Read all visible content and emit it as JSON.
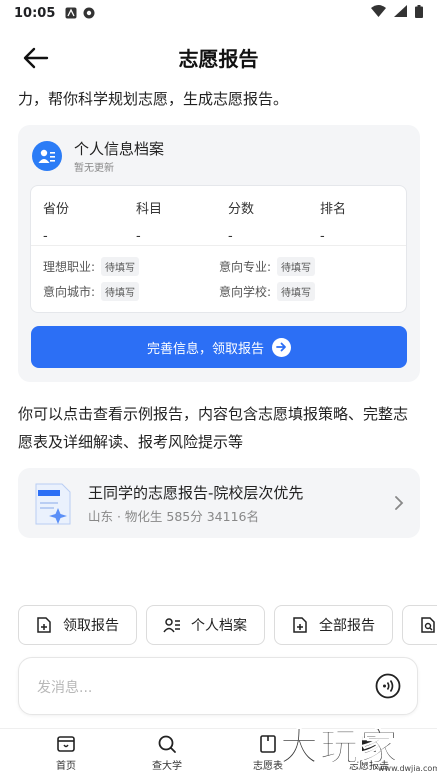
{
  "status_bar": {
    "time": "10:05"
  },
  "header": {
    "title": "志愿报告",
    "back_icon": "arrow-left-icon"
  },
  "intro": "力，帮你科学规划志愿，生成志愿报告。",
  "profile": {
    "title": "个人信息档案",
    "subtitle": "暂无更新",
    "scores": [
      {
        "label": "省份",
        "value": "-"
      },
      {
        "label": "科目",
        "value": "-"
      },
      {
        "label": "分数",
        "value": "-"
      },
      {
        "label": "排名",
        "value": "-"
      }
    ],
    "prefs": [
      {
        "label": "理想职业:",
        "tag": "待填写"
      },
      {
        "label": "意向专业:",
        "tag": "待填写"
      },
      {
        "label": "意向城市:",
        "tag": "待填写"
      },
      {
        "label": "意向学校:",
        "tag": "待填写"
      }
    ],
    "button": "完善信息，领取报告",
    "accent": "#2c6ff5"
  },
  "description": "你可以点击查看示例报告，内容包含志愿填报策略、完整志愿表及详细解读、报考风险提示等",
  "sample_report": {
    "title": "王同学的志愿报告-院校层次优先",
    "meta": "山东 · 物化生 585分 34116名"
  },
  "chips": [
    {
      "label": "领取报告",
      "icon": "report-add-icon"
    },
    {
      "label": "个人档案",
      "icon": "profile-icon"
    },
    {
      "label": "全部报告",
      "icon": "report-list-icon"
    },
    {
      "label": "",
      "icon": "report-search-icon"
    }
  ],
  "composer": {
    "placeholder": "发消息..."
  },
  "tabs": [
    {
      "label": "首页",
      "icon": "home-icon"
    },
    {
      "label": "查大学",
      "icon": "search-icon"
    },
    {
      "label": "志愿表",
      "icon": "bookmark-icon"
    },
    {
      "label": "志愿报告",
      "icon": "report-icon"
    }
  ],
  "watermark": {
    "main": "大玩家",
    "sub": "www.dwjia.com"
  }
}
